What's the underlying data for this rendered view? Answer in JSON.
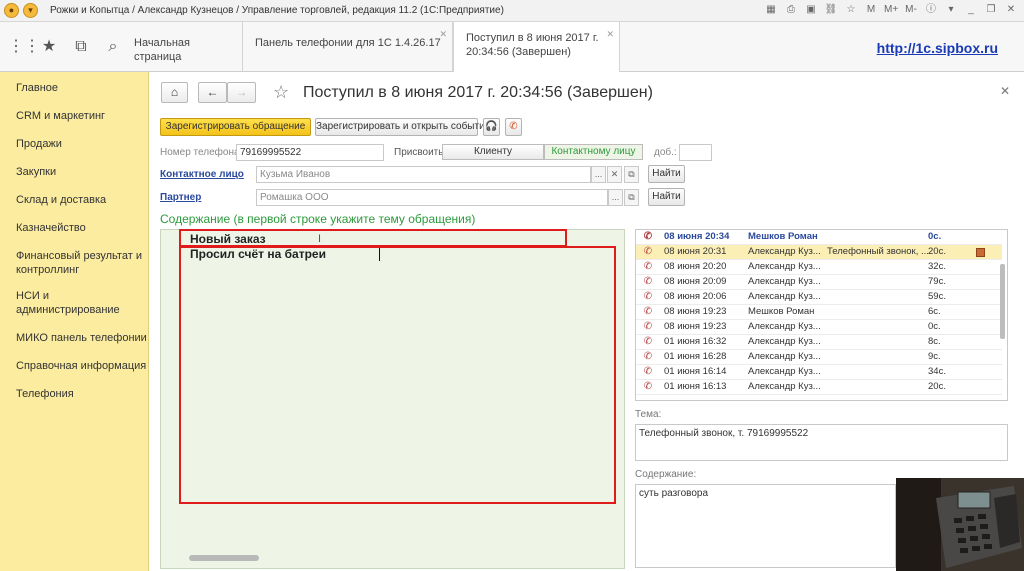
{
  "window": {
    "title": "Рожки и Копытца / Александр Кузнецов / Управление торговлей, редакция 11.2  (1С:Предприятие)"
  },
  "tabs": [
    {
      "label": "Начальная страница"
    },
    {
      "label": "Панель телефонии для 1С 1.4.26.17"
    },
    {
      "label_line1": "Поступил в 8 июня 2017 г.",
      "label_line2": "20:34:56 (Завершен)"
    }
  ],
  "branding": {
    "link": "http://1c.sipbox.ru"
  },
  "sidebar": {
    "items": [
      {
        "label": "Главное"
      },
      {
        "label": "CRM и маркетинг"
      },
      {
        "label": "Продажи"
      },
      {
        "label": "Закупки"
      },
      {
        "label": "Склад и доставка"
      },
      {
        "label": "Казначейство"
      },
      {
        "label_line1": "Финансовый результат и",
        "label_line2": "контроллинг"
      },
      {
        "label_line1": "НСИ и",
        "label_line2": "администрирование"
      },
      {
        "label": "МИКО панель телефонии"
      },
      {
        "label": "Справочная информация"
      },
      {
        "label": "Телефония"
      }
    ]
  },
  "form": {
    "title": "Поступил в 8 июня 2017 г. 20:34:56 (Завершен)",
    "register_btn": "Зарегистрировать обращение",
    "register_open_btn": "Зарегистрировать и открыть событие",
    "phone_label": "Номер телефона:",
    "phone_value": "79169995522",
    "assign_label": "Присвоить:",
    "assign_client": "Клиенту",
    "assign_contact": "Контактному лицу",
    "ext_label": "доб.:",
    "ext_value": "",
    "contact_label": "Контактное лицо",
    "contact_value": "Кузьма Иванов",
    "partner_label": "Партнер",
    "partner_value": "Ромашка ООО",
    "find_label": "Найти",
    "dots": "...",
    "content_title": "Содержание (в первой строке укажите тему обращения)",
    "content_line1": "Новый заказ",
    "content_line2": "Просил счёт на батреи"
  },
  "calls": {
    "rows": [
      {
        "date": "08 июня 20:34",
        "name": "Мешков Роман",
        "type": "",
        "duration": "0с.",
        "header": true
      },
      {
        "date": "08 июня 20:31",
        "name": "Александр Куз...",
        "type": "Телефонный звонок, ...",
        "duration": "20с.",
        "selected": true
      },
      {
        "date": "08 июня 20:20",
        "name": "Александр Куз...",
        "type": "",
        "duration": "32с."
      },
      {
        "date": "08 июня 20:09",
        "name": "Александр Куз...",
        "type": "",
        "duration": "79с."
      },
      {
        "date": "08 июня 20:06",
        "name": "Александр Куз...",
        "type": "",
        "duration": "59с."
      },
      {
        "date": "08 июня 19:23",
        "name": "Мешков Роман",
        "type": "",
        "duration": "6с."
      },
      {
        "date": "08 июня 19:23",
        "name": "Александр Куз...",
        "type": "",
        "duration": "0с."
      },
      {
        "date": "01 июня 16:32",
        "name": "Александр Куз...",
        "type": "",
        "duration": "8с."
      },
      {
        "date": "01 июня 16:28",
        "name": "Александр Куз...",
        "type": "",
        "duration": "9с."
      },
      {
        "date": "01 июня 16:14",
        "name": "Александр Куз...",
        "type": "",
        "duration": "34с."
      },
      {
        "date": "01 июня 16:13",
        "name": "Александр Куз...",
        "type": "",
        "duration": "20с."
      }
    ],
    "theme_label": "Тема:",
    "theme_value": "Телефонный звонок, т. 79169995522",
    "content_label": "Содержание:",
    "content_value": "суть разговора"
  },
  "colors": {
    "sidebar": "#fbeca0",
    "primary_button": "#f4c21a",
    "highlight_box": "#e01b1b",
    "section_title": "#2d9a3c",
    "selected_row": "#fbefb6"
  }
}
